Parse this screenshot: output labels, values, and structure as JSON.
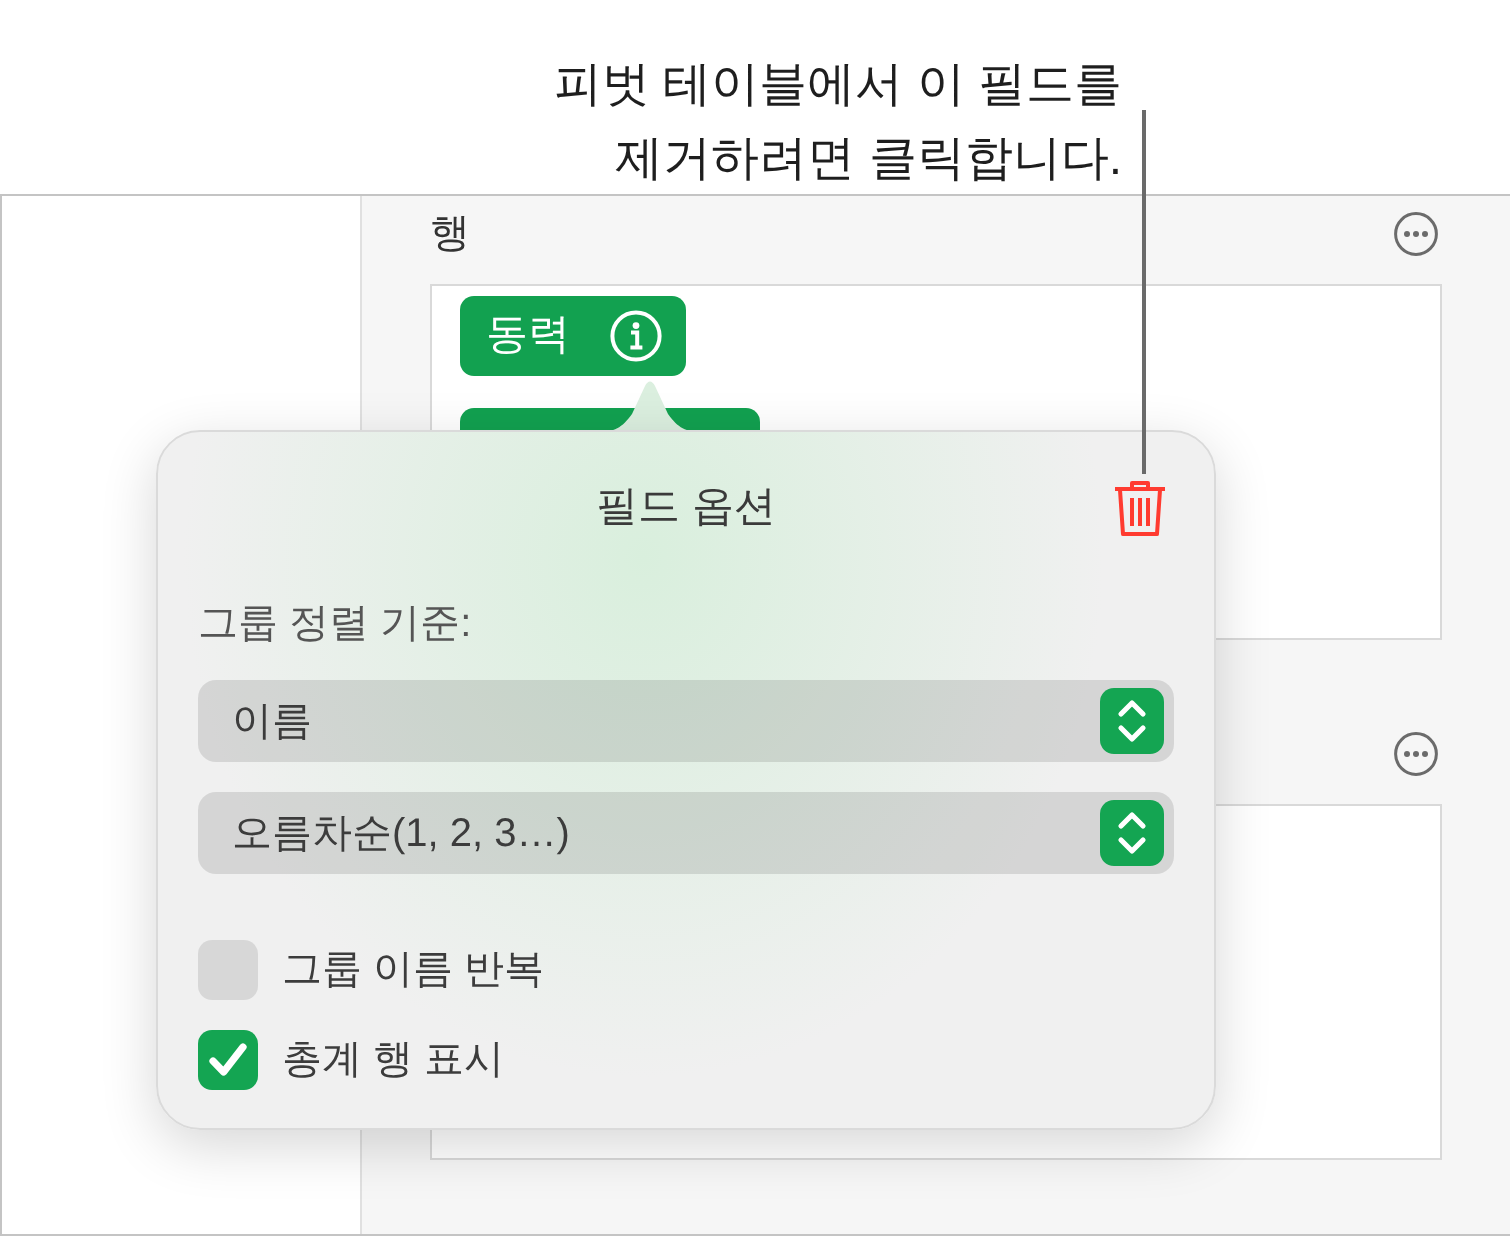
{
  "callout": {
    "lines": [
      "피벗 테이블에서 이 필드를",
      "제거하려면 클릭합니다."
    ]
  },
  "sections": [
    {
      "title": "행",
      "title_covered": false,
      "fields": [
        {
          "label": "동력",
          "covered": false
        },
        {
          "covered": true
        }
      ]
    },
    {
      "title_covered": true
    }
  ],
  "popover": {
    "title": "필드 옵션",
    "sort_label": "그룹 정렬 기준:",
    "selects": [
      {
        "value": "이름"
      },
      {
        "value": "오름차순(1, 2, 3…)"
      }
    ],
    "options": [
      {
        "label": "그룹 이름 반복",
        "checked": false
      },
      {
        "label": "총계 행 표시",
        "checked": true
      }
    ]
  }
}
